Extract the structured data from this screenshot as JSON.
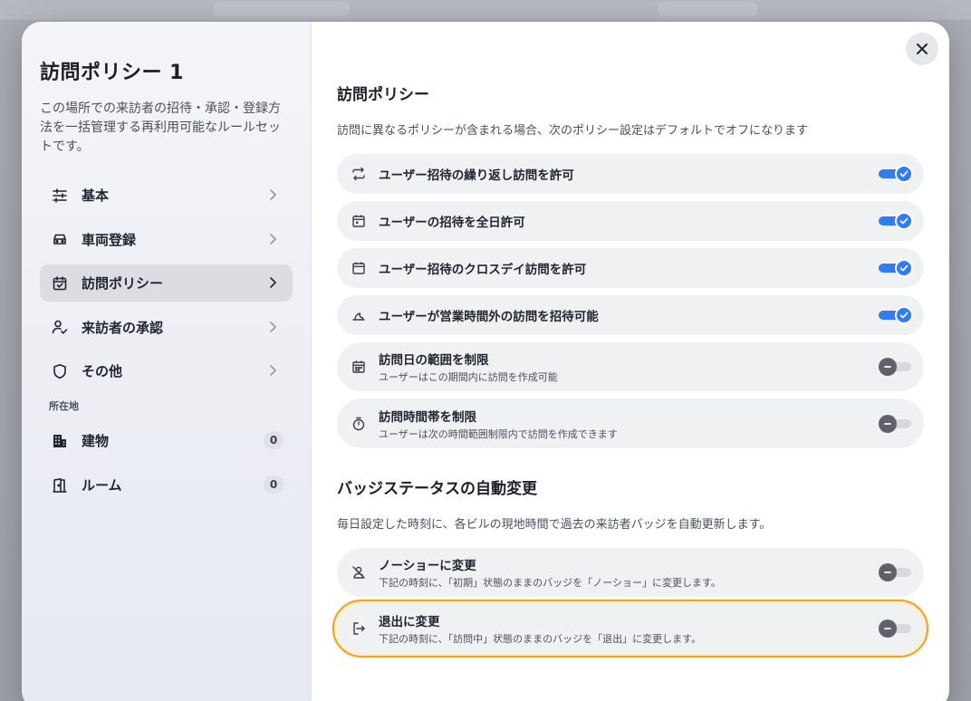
{
  "modal": {
    "title": "訪問ポリシー 1",
    "description": "この場所での来訪者の招待・承認・登録方法を一括管理する再利用可能なルールセットです。"
  },
  "nav": {
    "items": [
      {
        "label": "基本",
        "icon": "sliders-icon"
      },
      {
        "label": "車両登録",
        "icon": "car-icon"
      },
      {
        "label": "訪問ポリシー",
        "icon": "calendar-check-icon"
      },
      {
        "label": "来訪者の承認",
        "icon": "user-check-icon"
      },
      {
        "label": "その他",
        "icon": "shield-icon"
      }
    ],
    "section_label": "所在地",
    "locations": [
      {
        "label": "建物",
        "count": "0",
        "icon": "building-icon"
      },
      {
        "label": "ルーム",
        "count": "0",
        "icon": "door-icon"
      }
    ]
  },
  "policy": {
    "heading": "訪問ポリシー",
    "subtext": "訪問に異なるポリシーが含まれる場合、次のポリシー設定はデフォルトでオフになります",
    "rows": [
      {
        "label": "ユーザー招待の繰り返し訪問を許可",
        "hint": "",
        "on": true
      },
      {
        "label": "ユーザーの招待を全日許可",
        "hint": "",
        "on": true
      },
      {
        "label": "ユーザー招待のクロスデイ訪問を許可",
        "hint": "",
        "on": true
      },
      {
        "label": "ユーザーが営業時間外の訪問を招待可能",
        "hint": "",
        "on": true
      },
      {
        "label": "訪問日の範囲を制限",
        "hint": "ユーザーはこの期間内に訪問を作成可能",
        "on": false
      },
      {
        "label": "訪問時間帯を制限",
        "hint": "ユーザーは次の時間範囲制限内で訪問を作成できます",
        "on": false
      }
    ]
  },
  "badge": {
    "heading": "バッジステータスの自動変更",
    "subtext": "毎日設定した時刻に、各ビルの現地時間で過去の来訪者バッジを自動更新します。",
    "rows": [
      {
        "label": "ノーショーに変更",
        "hint": "下記の時刻に、「初期」状態のままのバッジを「ノーショー」に変更します。",
        "on": false
      },
      {
        "label": "退出に変更",
        "hint": "下記の時刻に、「訪問中」状態のままのバッジを「退出」に変更します。",
        "on": false
      }
    ]
  },
  "colors": {
    "accent": "#2f7cf6",
    "highlight": "#f4a11f"
  }
}
